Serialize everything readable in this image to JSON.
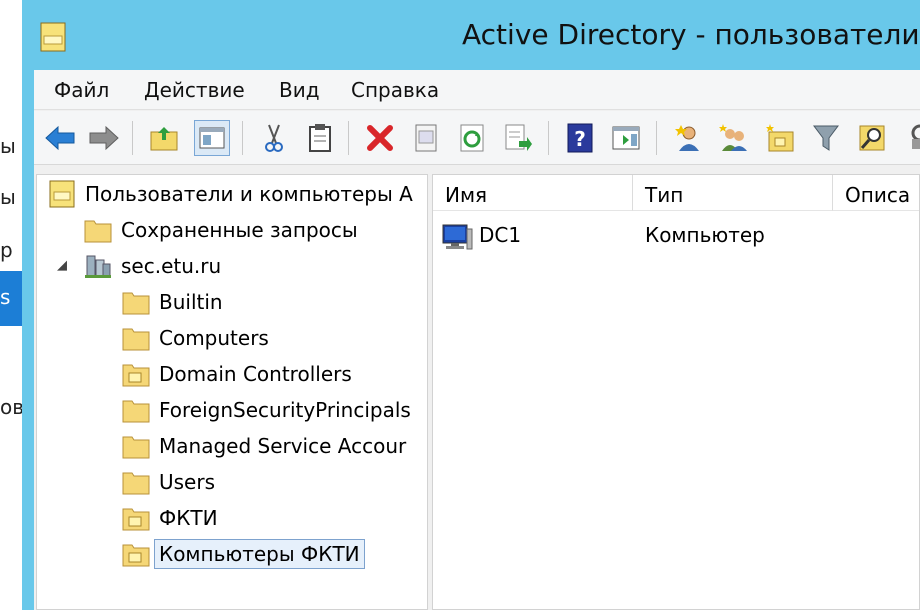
{
  "background_window": {
    "fragments": [
      "ы",
      "ы",
      "р",
      "ов"
    ],
    "selected_fragment": "s"
  },
  "window": {
    "title": "Active Directory - пользователи и",
    "title_icon": "ad-folder-icon"
  },
  "menu": {
    "items": [
      "Файл",
      "Действие",
      "Вид",
      "Справка"
    ]
  },
  "toolbar": {
    "buttons": [
      "back-icon",
      "forward-icon",
      "up-folder-icon",
      "show-hide-console-tree-icon",
      "cut-icon",
      "copy-icon",
      "delete-icon",
      "properties-icon",
      "refresh-icon",
      "export-list-icon",
      "help-icon",
      "show-action-pane-icon",
      "new-user-icon",
      "new-group-icon",
      "new-ou-icon",
      "filter-icon",
      "find-icon",
      "tools-icon"
    ]
  },
  "tree": {
    "root": "Пользователи и компьютеры A",
    "saved_queries": "Сохраненные запросы",
    "domain": "sec.etu.ru",
    "children": [
      {
        "label": "Builtin",
        "icon": "folder-icon"
      },
      {
        "label": "Computers",
        "icon": "folder-icon"
      },
      {
        "label": "Domain Controllers",
        "icon": "ou-folder-icon"
      },
      {
        "label": "ForeignSecurityPrincipals",
        "icon": "folder-icon"
      },
      {
        "label": "Managed Service Accour",
        "icon": "folder-icon"
      },
      {
        "label": "Users",
        "icon": "folder-icon"
      },
      {
        "label": "ФКТИ",
        "icon": "ou-folder-icon"
      },
      {
        "label": "Компьютеры ФКТИ",
        "icon": "ou-folder-icon",
        "selected": true
      }
    ]
  },
  "list": {
    "columns": [
      "Имя",
      "Тип",
      "Описа"
    ],
    "rows": [
      {
        "name": "DC1",
        "type": "Компьютер",
        "icon": "computer-icon"
      }
    ]
  },
  "colors": {
    "titlebar": "#69c8ea",
    "selection": "#e6f0fb",
    "selection_border": "#7da2ce"
  }
}
